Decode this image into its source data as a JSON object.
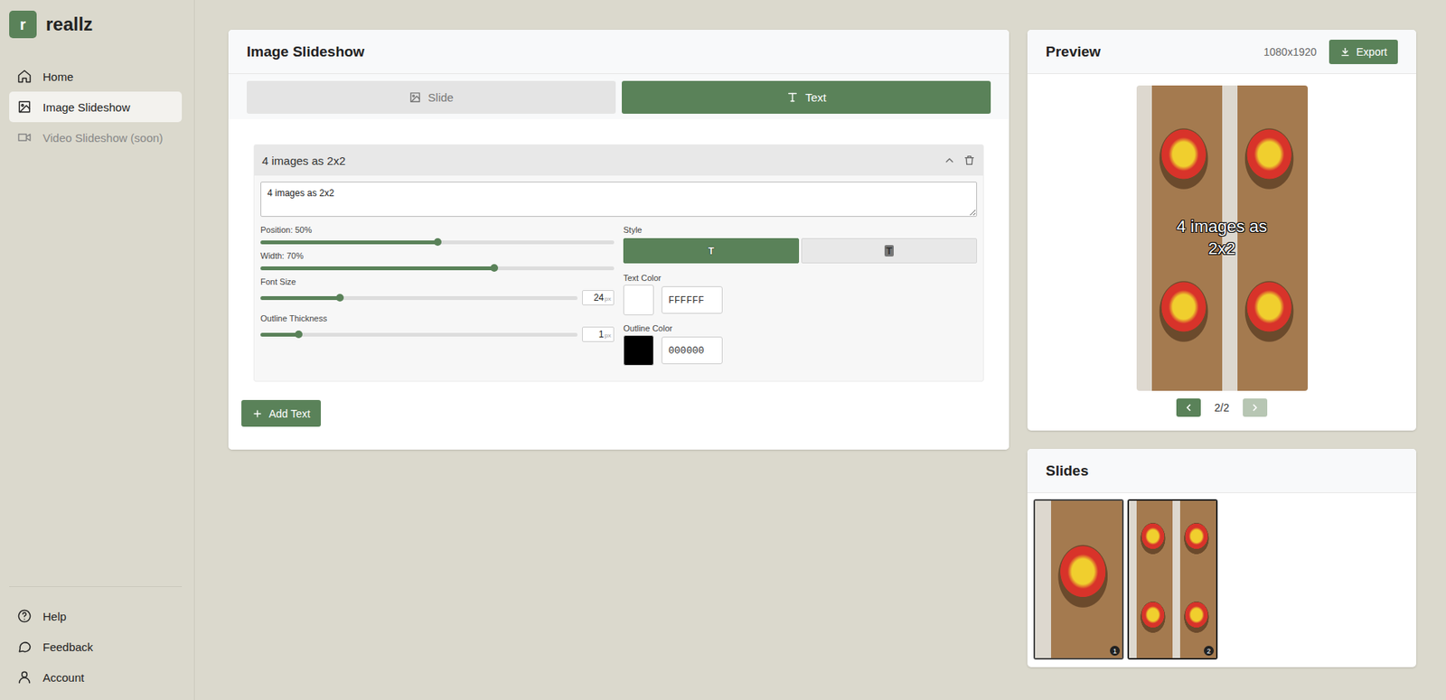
{
  "app": {
    "logo_letter": "r",
    "name": "reallz"
  },
  "sidebar": {
    "items": [
      {
        "label": "Home",
        "selected": false,
        "disabled": false
      },
      {
        "label": "Image Slideshow",
        "selected": true,
        "disabled": false
      },
      {
        "label": "Video Slideshow (soon)",
        "selected": false,
        "disabled": true
      }
    ],
    "bottom_items": [
      {
        "label": "Help"
      },
      {
        "label": "Feedback"
      },
      {
        "label": "Account"
      }
    ]
  },
  "editor": {
    "title": "Image Slideshow",
    "tabs": [
      {
        "label": "Slide",
        "selected": false
      },
      {
        "label": "Text",
        "selected": true
      }
    ],
    "text_items": [
      {
        "title": "4 images as 2x2",
        "expanded": true,
        "text": "4 images as 2x2",
        "sliders": [
          {
            "kind": "plain",
            "label": "Position: 50%",
            "level": 0.5
          },
          {
            "kind": "plain",
            "label": "Width: 70%",
            "level": 0.66
          },
          {
            "kind": "input",
            "label": "Font Size",
            "level": 0.25,
            "value": "24",
            "unit": "px"
          },
          {
            "kind": "input",
            "label": "Outline Thickness",
            "level": 0.12,
            "value": "1",
            "unit": "px"
          }
        ],
        "style": {
          "label": "Style",
          "options": [
            {
              "label": "T",
              "selected": true
            },
            {
              "label": "T",
              "selected": false
            }
          ]
        },
        "colors": [
          {
            "label": "Text Color",
            "hex": "FFFFFF"
          },
          {
            "label": "Outline Color",
            "hex": "000000"
          }
        ]
      }
    ],
    "add_button": "Add Text"
  },
  "preview": {
    "title": "Preview",
    "resolution": "1080x1920",
    "export_label": "Export",
    "images": 4,
    "overlay_text": "4 images as 2x2",
    "page": "2/2",
    "prev_disabled": false,
    "next_disabled": true
  },
  "slides": {
    "title": "Slides",
    "items": [
      {
        "number": "1",
        "images": 1,
        "selected": false
      },
      {
        "number": "2",
        "images": 4,
        "selected": true
      }
    ]
  }
}
